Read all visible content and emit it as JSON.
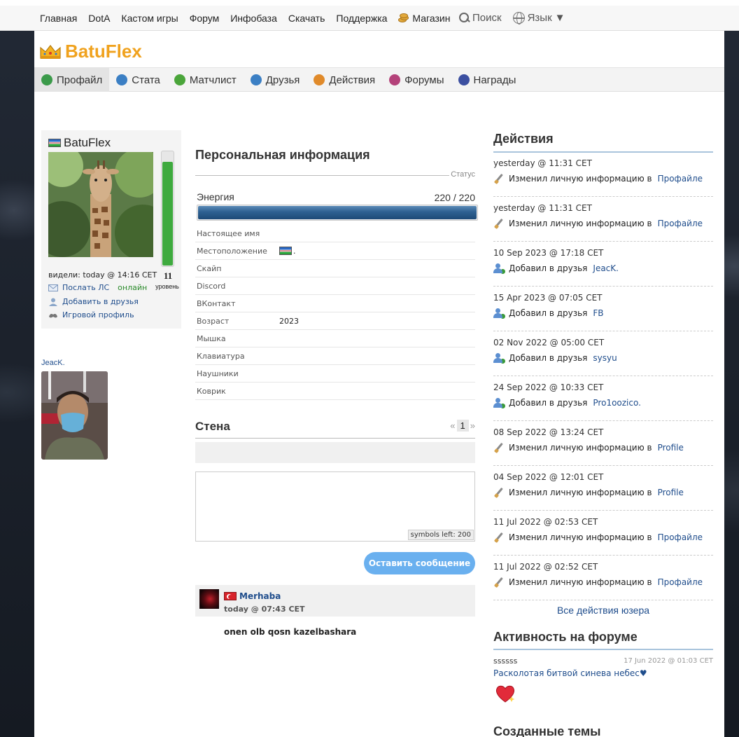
{
  "topnav": {
    "links": [
      "Главная",
      "DotA",
      "Кастом игры",
      "Форум",
      "Инфобаза",
      "Скачать",
      "Поддержка"
    ],
    "shop": "Магазин",
    "search": "Поиск",
    "language": "Язык"
  },
  "brand": {
    "name": "BatuFlex"
  },
  "tabs": [
    {
      "label": "Профайл",
      "color": "#3b9a4a"
    },
    {
      "label": "Стата",
      "color": "#3b7fc4"
    },
    {
      "label": "Матчлист",
      "color": "#4aa53a"
    },
    {
      "label": "Друзья",
      "color": "#3b7fc4"
    },
    {
      "label": "Действия",
      "color": "#e08a2a"
    },
    {
      "label": "Форумы",
      "color": "#b4427a"
    },
    {
      "label": "Награды",
      "color": "#3b4fa0"
    }
  ],
  "profile": {
    "username": "BatuFlex",
    "level": "11",
    "level_label": "уровень",
    "level_fill": 0.9,
    "seen": "видели: today @ 14:16 CET",
    "send_pm": "Послать ЛС",
    "online": "онлайн",
    "add_friend": "Добавить в друзья",
    "game_profile": "Игровой профиль"
  },
  "friend": {
    "name": "JeacK."
  },
  "personal": {
    "title": "Персональная информация",
    "status_label": "Статус",
    "energy_label": "Энергия",
    "energy_value": "220 / 220",
    "energy_fill": 1.0,
    "rows": [
      {
        "k": "Настоящее имя",
        "v": ""
      },
      {
        "k": "Местоположение",
        "v": "."
      },
      {
        "k": "Скайп",
        "v": ""
      },
      {
        "k": "Discord",
        "v": ""
      },
      {
        "k": "ВКонтакт",
        "v": ""
      },
      {
        "k": "Возраст",
        "v": "2023"
      },
      {
        "k": "Мышка",
        "v": ""
      },
      {
        "k": "Клавиатура",
        "v": ""
      },
      {
        "k": "Наушники",
        "v": ""
      },
      {
        "k": "Коврик",
        "v": ""
      }
    ]
  },
  "wall": {
    "title": "Стена",
    "page_prev": "«",
    "page": "1",
    "page_next": "»",
    "symbols_left": "symbols left: 200",
    "send_label": "Оставить сообщение",
    "post": {
      "author": "Merhaba",
      "time": "today @ 07:43 CET",
      "text": "onen olb qosn kazelbashara"
    }
  },
  "actions": {
    "title": "Действия",
    "items": [
      {
        "when": "yesterday @ 11:31 CET",
        "text": "Изменил личную информацию в",
        "link": "Профайле",
        "icon": "wrench"
      },
      {
        "when": "yesterday @ 11:31 CET",
        "text": "Изменил личную информацию в",
        "link": "Профайле",
        "icon": "wrench"
      },
      {
        "when": "10 Sep 2023 @ 17:18 CET",
        "text": "Добавил в друзья",
        "link": "JeacK.",
        "icon": "friend"
      },
      {
        "when": "15 Apr 2023 @ 07:05 CET",
        "text": "Добавил в друзья",
        "link": "FB",
        "icon": "friend"
      },
      {
        "when": "02 Nov 2022 @ 05:00 CET",
        "text": "Добавил в друзья",
        "link": "sysyu",
        "icon": "friend"
      },
      {
        "when": "24 Sep 2022 @ 10:33 CET",
        "text": "Добавил в друзья",
        "link": "Pro1oozico.",
        "icon": "friend"
      },
      {
        "when": "08 Sep 2022 @ 13:24 CET",
        "text": "Изменил личную информацию в",
        "link": "Profile",
        "icon": "wrench"
      },
      {
        "when": "04 Sep 2022 @ 12:01 CET",
        "text": "Изменил личную информацию в",
        "link": "Profile",
        "icon": "wrench"
      },
      {
        "when": "11 Jul 2022 @ 02:53 CET",
        "text": "Изменил личную информацию в",
        "link": "Профайле",
        "icon": "wrench"
      },
      {
        "when": "11 Jul 2022 @ 02:52 CET",
        "text": "Изменил личную информацию в",
        "link": "Профайле",
        "icon": "wrench"
      }
    ],
    "all": "Все действия юзера"
  },
  "forum": {
    "title": "Активность на форуме",
    "post_title": "ssssss",
    "post_date": "17 Jun 2022 @ 01:03 CET",
    "topic": "Расколотая битвой синева небес♥"
  },
  "created": {
    "title": "Созданные темы"
  }
}
